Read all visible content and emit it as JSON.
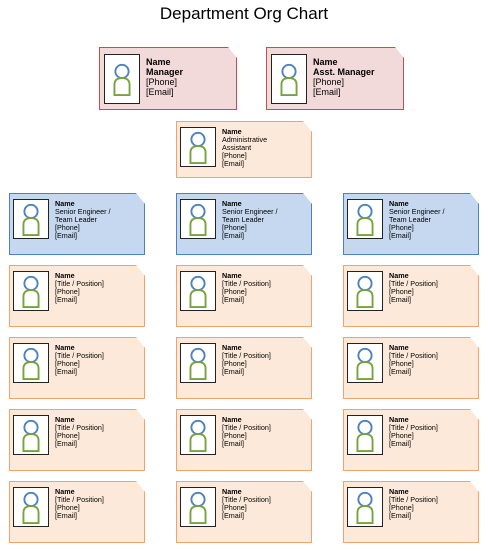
{
  "title": "Department Org Chart",
  "colors": {
    "manager": "#f2d9da",
    "assistant": "#fde9d9",
    "lead": "#c5d8ef",
    "member": "#fde9d9"
  },
  "icon": "person-placeholder-icon",
  "manager": {
    "name": "Name",
    "role": "Manager",
    "phone": "[Phone]",
    "email": "[Email]"
  },
  "asst_manager": {
    "name": "Name",
    "role": "Asst. Manager",
    "phone": "[Phone]",
    "email": "[Email]"
  },
  "admin_assistant": {
    "name": "Name",
    "role1": "Administrative",
    "role2": "Assistant",
    "phone": "[Phone]",
    "email": "[Email]"
  },
  "leads": [
    {
      "name": "Name",
      "role1": "Senior Engineer /",
      "role2": "Team Leader",
      "phone": "[Phone]",
      "email": "[Email]"
    },
    {
      "name": "Name",
      "role1": "Senior Engineer /",
      "role2": "Team Leader",
      "phone": "[Phone]",
      "email": "[Email]"
    },
    {
      "name": "Name",
      "role1": "Senior Engineer /",
      "role2": "Team Leader",
      "phone": "[Phone]",
      "email": "[Email]"
    }
  ],
  "member": {
    "name": "Name",
    "title": "[Title / Position]",
    "phone": "[Phone]",
    "email": "[Email]"
  }
}
